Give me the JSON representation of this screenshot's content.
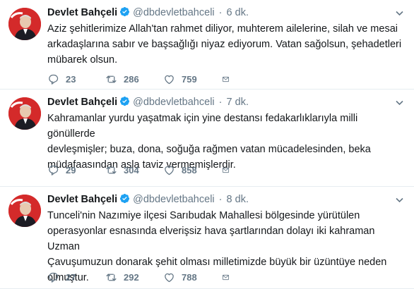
{
  "tweets": [
    {
      "name": "Devlet Bahçeli",
      "handle": "@dbdevletbahceli",
      "separator": "·",
      "time": "6 dk.",
      "text": "Aziz şehitlerimize Allah'tan rahmet diliyor, muhterem ailelerine, silah ve mesai\narkadaşlarına sabır ve başsağlığı niyaz ediyorum. Vatan sağolsun, şehadetleri\nmübarek olsun.",
      "replies": "23",
      "retweets": "286",
      "likes": "759"
    },
    {
      "name": "Devlet Bahçeli",
      "handle": "@dbdevletbahceli",
      "separator": "·",
      "time": "7 dk.",
      "text": "Kahramanlar yurdu yaşatmak için yine destansı fedakarlıklarıyla milli gönüllerde\ndevleşmişler; buza, dona, soğuğa rağmen vatan mücadelesinden, beka\nmüdafaasından asla taviz vermemişlerdir.",
      "replies": "29",
      "retweets": "304",
      "likes": "858"
    },
    {
      "name": "Devlet Bahçeli",
      "handle": "@dbdevletbahceli",
      "separator": "·",
      "time": "8 dk.",
      "text": "Tunceli'nin Nazımiye ilçesi Sarıbudak Mahallesi bölgesinde yürütülen\noperasyonlar esnasında elverişsiz hava şartlarından dolayı iki kahraman Uzman\nÇavuşumuzun donarak şehit olması milletimizde büyük bir üzüntüye neden\nolmuştur.",
      "replies": "27",
      "retweets": "292",
      "likes": "788"
    }
  ],
  "colors": {
    "verified": "#1da1f2",
    "muted": "#657786",
    "text": "#14171a",
    "divider": "#e6ecf0",
    "avatar_bg": "#d42a2a"
  },
  "icons": [
    "verified-badge-icon",
    "chevron-down-icon",
    "reply-icon",
    "retweet-icon",
    "like-icon",
    "message-icon"
  ]
}
